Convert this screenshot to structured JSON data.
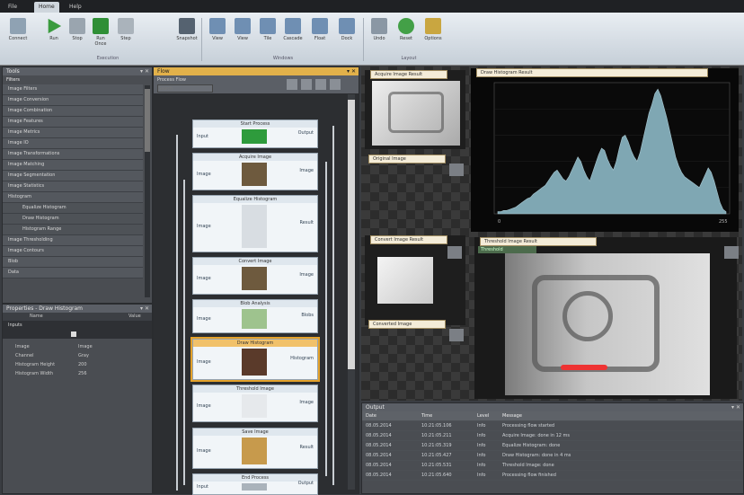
{
  "title_tabs": [
    {
      "label": "File"
    },
    {
      "label": "Home",
      "active": true
    },
    {
      "label": "Help"
    }
  ],
  "ribbon": {
    "buttons": [
      {
        "label": "Connect",
        "icon": "plug-icon"
      },
      {
        "label": "Run",
        "icon": "play-icon"
      },
      {
        "label": "Stop",
        "icon": "stop-icon"
      },
      {
        "label": "Run Once",
        "icon": "play-once-icon"
      },
      {
        "label": "Step",
        "icon": "step-icon"
      },
      {
        "label": "Snapshot",
        "icon": "camera-icon"
      },
      {
        "label": "View",
        "icon": "view-icon"
      },
      {
        "label": "View",
        "icon": "view-icon"
      },
      {
        "label": "Tile",
        "icon": "tile-icon"
      },
      {
        "label": "Cascade",
        "icon": "cascade-icon"
      },
      {
        "label": "Float",
        "icon": "float-icon"
      },
      {
        "label": "Dock",
        "icon": "dock-icon"
      },
      {
        "label": "Undo",
        "icon": "undo-icon"
      },
      {
        "label": "Reset",
        "icon": "reset-icon"
      },
      {
        "label": "Options",
        "icon": "options-icon"
      }
    ],
    "groups": [
      "Execution",
      "Windows",
      "Layout"
    ]
  },
  "tools_panel": {
    "title": "Tools",
    "root": "Filters",
    "items": [
      {
        "label": "Image Filters",
        "sub": false
      },
      {
        "label": "Image Conversion",
        "sub": false
      },
      {
        "label": "Image Combination",
        "sub": false
      },
      {
        "label": "Image Features",
        "sub": false
      },
      {
        "label": "Image Metrics",
        "sub": false
      },
      {
        "label": "Image IO",
        "sub": false
      },
      {
        "label": "Image Transformations",
        "sub": false
      },
      {
        "label": "Image Matching",
        "sub": false
      },
      {
        "label": "Image Segmentation",
        "sub": false
      },
      {
        "label": "Image Statistics",
        "sub": false
      },
      {
        "label": "Histogram",
        "sub": false
      },
      {
        "label": "Equalize Histogram",
        "sub": true
      },
      {
        "label": "Draw Histogram",
        "sub": true
      },
      {
        "label": "Histogram Range",
        "sub": true
      },
      {
        "label": "Image Thresholding",
        "sub": false
      },
      {
        "label": "Image Contours",
        "sub": false
      },
      {
        "label": "Blob",
        "sub": false
      },
      {
        "label": "Data",
        "sub": false
      }
    ]
  },
  "properties_panel": {
    "title": "Properties - Draw Histogram",
    "columns": [
      "Name",
      "Value"
    ],
    "section": "Inputs",
    "rows": [
      {
        "name": "Image",
        "value": "Image"
      },
      {
        "name": "Channel",
        "value": "Gray"
      },
      {
        "name": "Histogram Height",
        "value": "200"
      },
      {
        "name": "Histogram Width",
        "value": "256"
      }
    ]
  },
  "flow_panel": {
    "title": "Flow",
    "subtitle": "Process Flow",
    "filter_placeholder": "Search",
    "nodes": [
      {
        "title": "Start Process",
        "in": "Input",
        "out": "Output",
        "icon": "arrow-down-icon",
        "top": 133,
        "h": 30
      },
      {
        "title": "Acquire Image",
        "in": "Image",
        "out": "Image",
        "icon": "image-icon",
        "top": 170,
        "h": 40
      },
      {
        "title": "Equalize Histogram",
        "in": "Image",
        "out": "Result",
        "icon": "chart-icon",
        "top": 217,
        "h": 62
      },
      {
        "title": "Convert Image",
        "in": "Image",
        "out": "Image",
        "icon": "image-icon",
        "top": 286,
        "h": 40
      },
      {
        "title": "Blob Analysis",
        "in": "Image",
        "out": "Blobs",
        "icon": "blob-icon",
        "top": 333,
        "h": 36
      },
      {
        "title": "Draw Histogram",
        "in": "Image",
        "out": "Histogram",
        "icon": "draw-icon",
        "top": 377,
        "h": 44,
        "selected": true
      },
      {
        "title": "Threshold Image",
        "in": "Image",
        "out": "Image",
        "icon": "threshold-icon",
        "top": 428,
        "h": 40
      },
      {
        "title": "Save Image",
        "in": "Image",
        "out": "Result",
        "icon": "save-icon",
        "top": 476,
        "h": 44
      },
      {
        "title": "End Process",
        "in": "Input",
        "out": "Output",
        "icon": "end-icon",
        "top": 527,
        "h": 22
      }
    ]
  },
  "image_views": [
    {
      "title": "Acquire Image Result",
      "label": "Original Image"
    },
    {
      "title": "Histogram Plot",
      "label": "Histogram"
    },
    {
      "title": "Convert Image Result",
      "label": "Converted Image"
    },
    {
      "title": "Threshold Image Result",
      "label": "Threshold"
    }
  ],
  "histogram": {
    "title": "Draw Histogram Result",
    "xlim": [
      0,
      255
    ],
    "values": [
      2,
      2,
      3,
      3,
      4,
      5,
      6,
      8,
      10,
      12,
      14,
      15,
      18,
      20,
      22,
      24,
      26,
      30,
      34,
      38,
      40,
      36,
      32,
      30,
      34,
      40,
      46,
      52,
      48,
      40,
      34,
      30,
      38,
      46,
      54,
      60,
      58,
      50,
      44,
      40,
      48,
      60,
      70,
      72,
      66,
      58,
      52,
      48,
      56,
      68,
      80,
      92,
      100,
      110,
      114,
      108,
      98,
      88,
      76,
      64,
      52,
      44,
      38,
      34,
      32,
      30,
      28,
      26,
      24,
      30,
      36,
      42,
      38,
      30,
      20,
      10,
      4,
      2
    ]
  },
  "output_panel": {
    "title": "Output",
    "columns": [
      "Date",
      "Time",
      "Level",
      "Message"
    ],
    "rows": [
      {
        "date": "08.05.2014",
        "time": "10:21:05.106",
        "level": "Info",
        "msg": "Processing flow started"
      },
      {
        "date": "08.05.2014",
        "time": "10:21:05.211",
        "level": "Info",
        "msg": "Acquire Image: done in 12 ms"
      },
      {
        "date": "08.05.2014",
        "time": "10:21:05.319",
        "level": "Info",
        "msg": "Equalize Histogram: done"
      },
      {
        "date": "08.05.2014",
        "time": "10:21:05.427",
        "level": "Info",
        "msg": "Draw Histogram: done in 4 ms"
      },
      {
        "date": "08.05.2014",
        "time": "10:21:05.531",
        "level": "Info",
        "msg": "Threshold Image: done"
      },
      {
        "date": "08.05.2014",
        "time": "10:21:05.640",
        "level": "Info",
        "msg": "Processing flow finished"
      }
    ]
  }
}
